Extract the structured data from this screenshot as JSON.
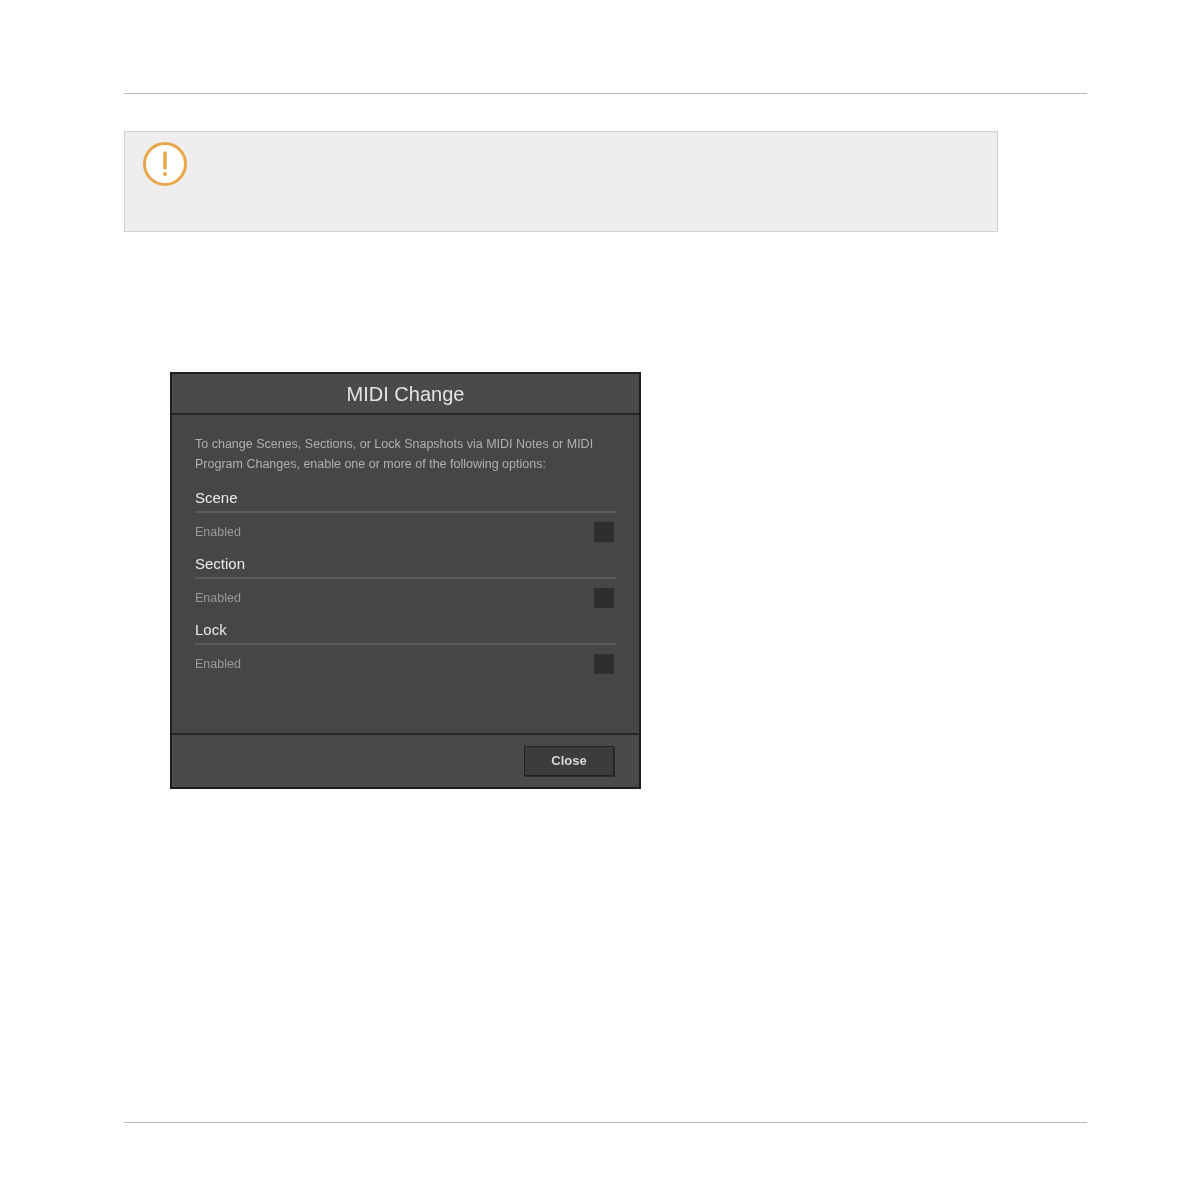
{
  "notice": {
    "kind": "warning"
  },
  "dialog": {
    "title": "MIDI Change",
    "description": "To change Scenes, Sections, or Lock Snapshots via MIDI Notes or MIDI Program Changes, enable one or more of the following options:",
    "options": [
      {
        "heading": "Scene",
        "label": "Enabled",
        "checked": false
      },
      {
        "heading": "Section",
        "label": "Enabled",
        "checked": false
      },
      {
        "heading": "Lock",
        "label": "Enabled",
        "checked": false
      }
    ],
    "buttons": [
      "Close"
    ]
  }
}
